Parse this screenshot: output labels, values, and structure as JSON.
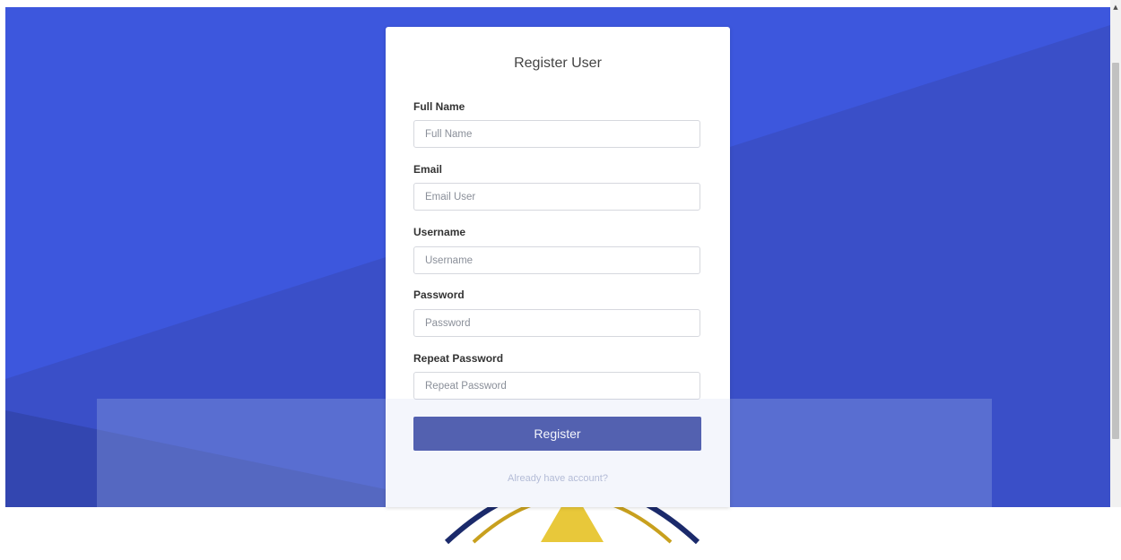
{
  "form": {
    "title": "Register User",
    "fields": [
      {
        "label": "Full Name",
        "placeholder": "Full Name"
      },
      {
        "label": "Email",
        "placeholder": "Email User"
      },
      {
        "label": "Username",
        "placeholder": "Username"
      },
      {
        "label": "Password",
        "placeholder": "Password"
      },
      {
        "label": "Repeat Password",
        "placeholder": "Repeat Password"
      }
    ],
    "submit_label": "Register",
    "login_link": "Already have account?"
  },
  "scrollbar": {
    "up_arrow": "▲"
  },
  "colors": {
    "background": "#3d57dd",
    "background_shade": "#3a4fc8",
    "button": "#4c5aab"
  }
}
